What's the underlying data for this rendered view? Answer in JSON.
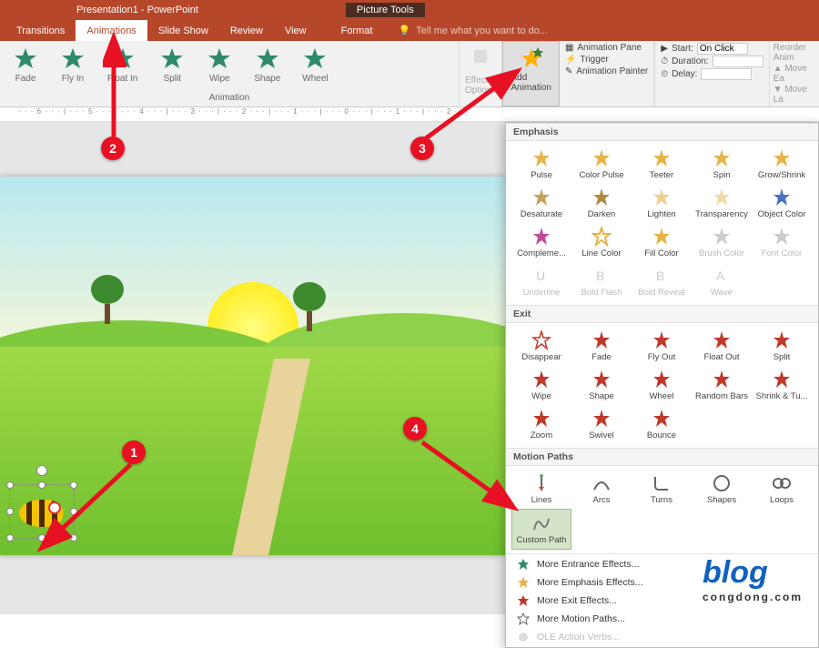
{
  "title": "Presentation1 - PowerPoint",
  "picture_tools": "Picture Tools",
  "tabs": {
    "transitions": "Transitions",
    "animations": "Animations",
    "slideshow": "Slide Show",
    "review": "Review",
    "view": "View",
    "format": "Format"
  },
  "tell_me": "Tell me what you want to do...",
  "ribbon": {
    "items": {
      "fade": "Fade",
      "flyin": "Fly In",
      "floatin": "Float In",
      "split": "Split",
      "wipe": "Wipe",
      "shape": "Shape",
      "wheel": "Wheel"
    },
    "group_label": "Animation",
    "effect_options": "Effect\nOptions",
    "add_animation": "Add\nAnimation",
    "adv": {
      "pane": "Animation Pane",
      "trigger": "Trigger",
      "painter": "Animation Painter"
    },
    "timing": {
      "start_label": "Start:",
      "start_value": "On Click",
      "duration_label": "Duration:",
      "duration_value": "",
      "delay_label": "Delay:",
      "delay_value": ""
    },
    "reorder": {
      "title": "Reorder Anim",
      "earlier": "Move Ea",
      "later": "Move La"
    }
  },
  "dropdown": {
    "emphasis_label": "Emphasis",
    "emphasis": {
      "pulse": "Pulse",
      "colorpulse": "Color Pulse",
      "teeter": "Teeter",
      "spin": "Spin",
      "growshrink": "Grow/Shrink",
      "desaturate": "Desaturate",
      "darken": "Darken",
      "lighten": "Lighten",
      "transparency": "Transparency",
      "objectcolor": "Object Color",
      "complementary": "Compleme...",
      "linecolor": "Line Color",
      "fillcolor": "Fill Color",
      "brushcolor": "Brush Color",
      "fontcolor": "Font Color",
      "underline": "Underline",
      "boldflash": "Bold Flash",
      "boldreveal": "Bold Reveal",
      "wave": "Wave"
    },
    "exit_label": "Exit",
    "exit": {
      "disappear": "Disappear",
      "fade": "Fade",
      "flyout": "Fly Out",
      "floatout": "Float Out",
      "split": "Split",
      "wipe": "Wipe",
      "shape": "Shape",
      "wheel": "Wheel",
      "randombars": "Random Bars",
      "shrinkturn": "Shrink & Tu...",
      "zoom": "Zoom",
      "swivel": "Swivel",
      "bounce": "Bounce"
    },
    "motion_label": "Motion Paths",
    "motion": {
      "lines": "Lines",
      "arcs": "Arcs",
      "turns": "Turns",
      "shapes": "Shapes",
      "loops": "Loops",
      "custompath": "Custom Path"
    },
    "more": {
      "entrance": "More Entrance Effects...",
      "emphasis": "More Emphasis Effects...",
      "exit": "More Exit Effects...",
      "motion": "More Motion Paths...",
      "ole": "OLE Action Verbs..."
    }
  },
  "callouts": {
    "c1": "1",
    "c2": "2",
    "c3": "3",
    "c4": "4"
  },
  "logo": {
    "main": "blog",
    "sub": "congdong.com"
  }
}
